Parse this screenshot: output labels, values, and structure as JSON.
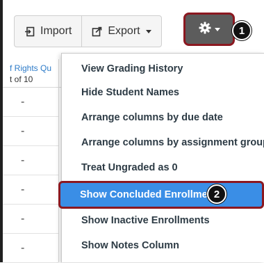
{
  "toolbar": {
    "import_label": "Import",
    "export_label": "Export",
    "settings_icon": "gear-icon",
    "import_icon": "import-icon",
    "export_icon": "export-icon"
  },
  "callouts": {
    "step1": "1",
    "step2": "2"
  },
  "gradebook": {
    "column_header_title": "f Rights Qu",
    "column_header_sub": "t of 10",
    "cells": [
      "-",
      "-",
      "-",
      "-",
      "-",
      "-"
    ]
  },
  "settings_menu": {
    "items": [
      "View Grading History",
      "Hide Student Names",
      "Arrange columns by due date",
      "Arrange columns by assignment group",
      "Treat Ungraded as 0",
      "Show Concluded Enrollments",
      "Show Inactive Enrollments",
      "Show Notes Column"
    ],
    "highlighted_index": 5
  },
  "colors": {
    "highlight": "#3a8ee6",
    "callout_border": "#8b1820",
    "link_blue": "#2d7bc8",
    "menu_text": "#2d3b45"
  }
}
